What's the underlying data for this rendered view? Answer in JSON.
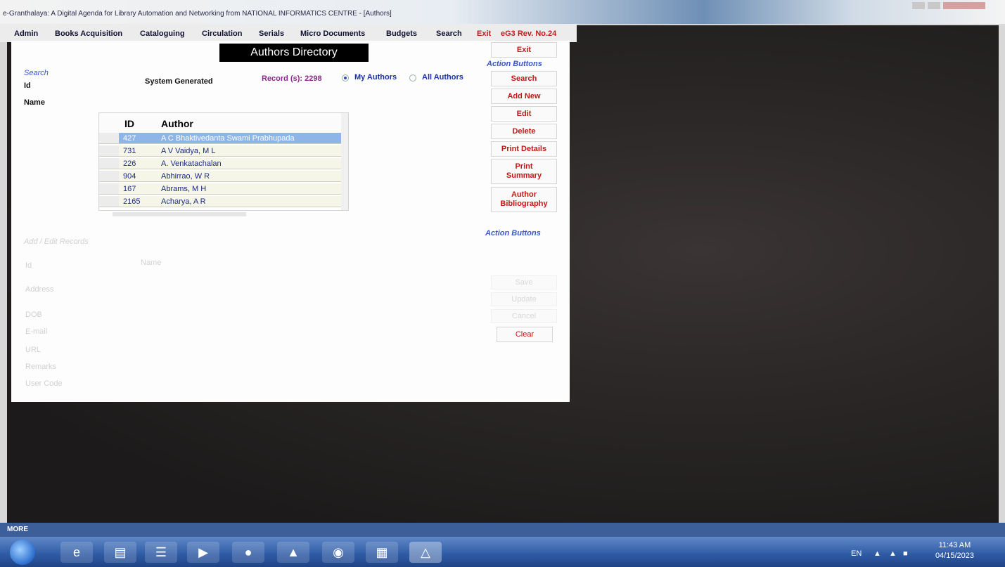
{
  "window": {
    "title": "e-Granthalaya: A Digital Agenda for Library Automation and Networking from NATIONAL INFORMATICS CENTRE - [Authors]"
  },
  "menu": [
    "Admin",
    "Books Acquisition",
    "Cataloguing",
    "Circulation",
    "Serials",
    "Micro Documents",
    "Budgets",
    "Search",
    "Exit",
    "eG3 Rev. No.24"
  ],
  "directory": {
    "title": "Authors Directory",
    "search_section": "Search",
    "id_label": "Id",
    "id_value": "System Generated",
    "name_label": "Name",
    "record_count": "Record (s): 2298",
    "radio_my": "My Authors",
    "radio_all": "All Authors",
    "selected_radio": "My Authors"
  },
  "grid": {
    "columns": [
      "ID",
      "Author"
    ],
    "rows": [
      {
        "id": "427",
        "author": "A C Bhaktivedanta Swami Prabhupada",
        "selected": true
      },
      {
        "id": "731",
        "author": "A V Vaidya, M L"
      },
      {
        "id": "226",
        "author": "A. Venkatachalan"
      },
      {
        "id": "904",
        "author": "Abhirrao, W R"
      },
      {
        "id": "167",
        "author": "Abrams, M H"
      },
      {
        "id": "2165",
        "author": "Acharya, A R"
      }
    ]
  },
  "actions": {
    "section_label": "Action Buttons",
    "exit": "Exit",
    "search": "Search",
    "add_new": "Add New",
    "edit": "Edit",
    "delete": "Delete",
    "print_details": "Print Details",
    "print_summary": "Print Summary",
    "author_bibliography": "Author Bibliography"
  },
  "form": {
    "section_label": "Add / Edit Records",
    "action_label": "Action Buttons",
    "id_label": "Id",
    "name_label": "Name",
    "address_label": "Address",
    "dob_label": "DOB",
    "email_label": "E-mail",
    "url_label": "URL",
    "remarks_label": "Remarks",
    "usercode_label": "User Code",
    "save": "Save",
    "update": "Update",
    "cancel": "Cancel",
    "clear": "Clear"
  },
  "taskbar": {
    "more": "MORE",
    "lang": "EN",
    "time": "11:43 AM",
    "date": "04/15/2023",
    "icons": [
      "ie-icon",
      "explorer-icon",
      "word-icon",
      "media-player-icon",
      "firefox-icon",
      "image-viewer-icon",
      "chrome-icon",
      "excel-icon",
      "app-icon"
    ]
  }
}
